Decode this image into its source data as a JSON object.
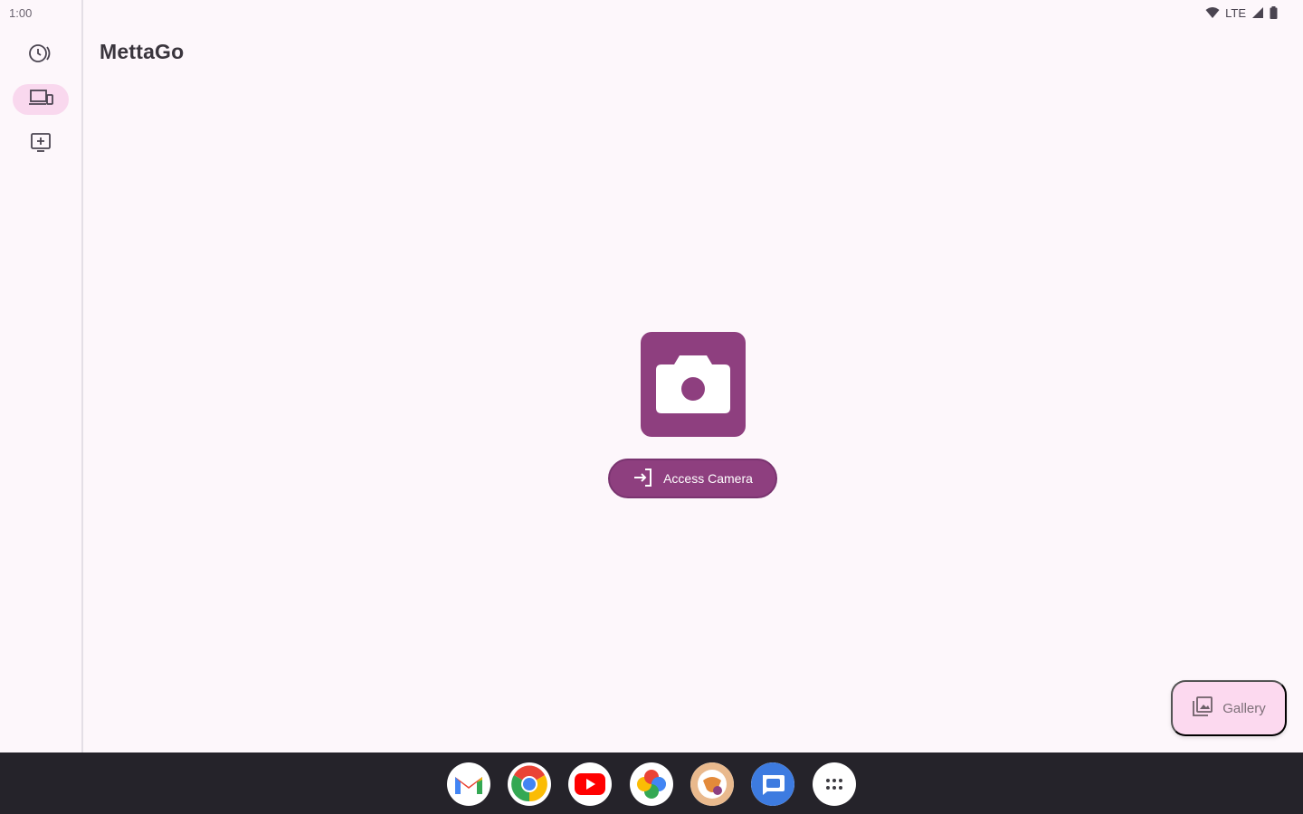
{
  "status_bar": {
    "time": "1:00",
    "network": "LTE",
    "icons": [
      "wifi-icon",
      "signal-icon",
      "battery-icon"
    ]
  },
  "app": {
    "title": "MettaGo"
  },
  "nav_rail": {
    "items": [
      {
        "icon": "history-icon",
        "active": false
      },
      {
        "icon": "devices-icon",
        "active": true
      },
      {
        "icon": "add-to-screen-icon",
        "active": false
      }
    ]
  },
  "main": {
    "camera_icon": "camera-icon",
    "access_button": {
      "icon": "login-icon",
      "label": "Access Camera"
    }
  },
  "gallery_fab": {
    "icon": "gallery-icon",
    "label": "Gallery"
  },
  "taskbar": {
    "apps": [
      "gmail-icon",
      "chrome-icon",
      "youtube-icon",
      "photos-icon",
      "custom-app-icon",
      "messages-icon",
      "app-drawer-icon"
    ]
  },
  "colors": {
    "background": "#fdf7fb",
    "primary": "#8e3f7f",
    "rail_active": "#f9d8ee",
    "fab": "#fcd9ef",
    "taskbar": "#25232a"
  }
}
